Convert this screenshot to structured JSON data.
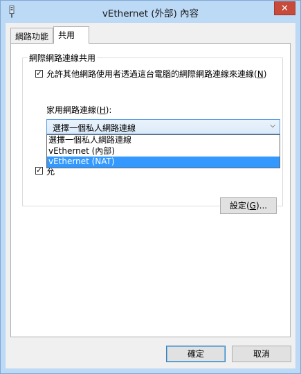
{
  "window": {
    "title": "vEthernet (外部) 內容",
    "close_glyph": "✕"
  },
  "tabs": [
    {
      "label": "網路功能",
      "active": false
    },
    {
      "label": "共用",
      "active": true
    }
  ],
  "sharing": {
    "group_title": "網際網路連線共用",
    "allow_sharing": {
      "checked": true,
      "label": "允許其他網路使用者透過這台電腦的網際網路連線來連線",
      "hotkey": "N"
    },
    "home_network": {
      "label": "家用網路連線",
      "hotkey": "H",
      "selected": "選擇一個私人網路連線",
      "options": [
        "選擇一個私人網路連線",
        "vEthernet (內部)",
        "vEthernet (NAT)"
      ],
      "highlighted_index": 2
    },
    "allow_control": {
      "checked": true,
      "label_visible": "允"
    },
    "settings_button": {
      "label": "設定",
      "hotkey": "G",
      "suffix": "..."
    }
  },
  "footer": {
    "ok_label": "確定",
    "cancel_label": "取消"
  },
  "icons": {
    "window_icon": "network-adapter-icon",
    "dropdown_arrow": "chevron-down-icon",
    "check": "checkmark-icon"
  },
  "colors": {
    "title_bar": "#bcd9f6",
    "close_button": "#c74a3a",
    "highlight": "#3399ff",
    "dropdown_border": "#569de5"
  }
}
